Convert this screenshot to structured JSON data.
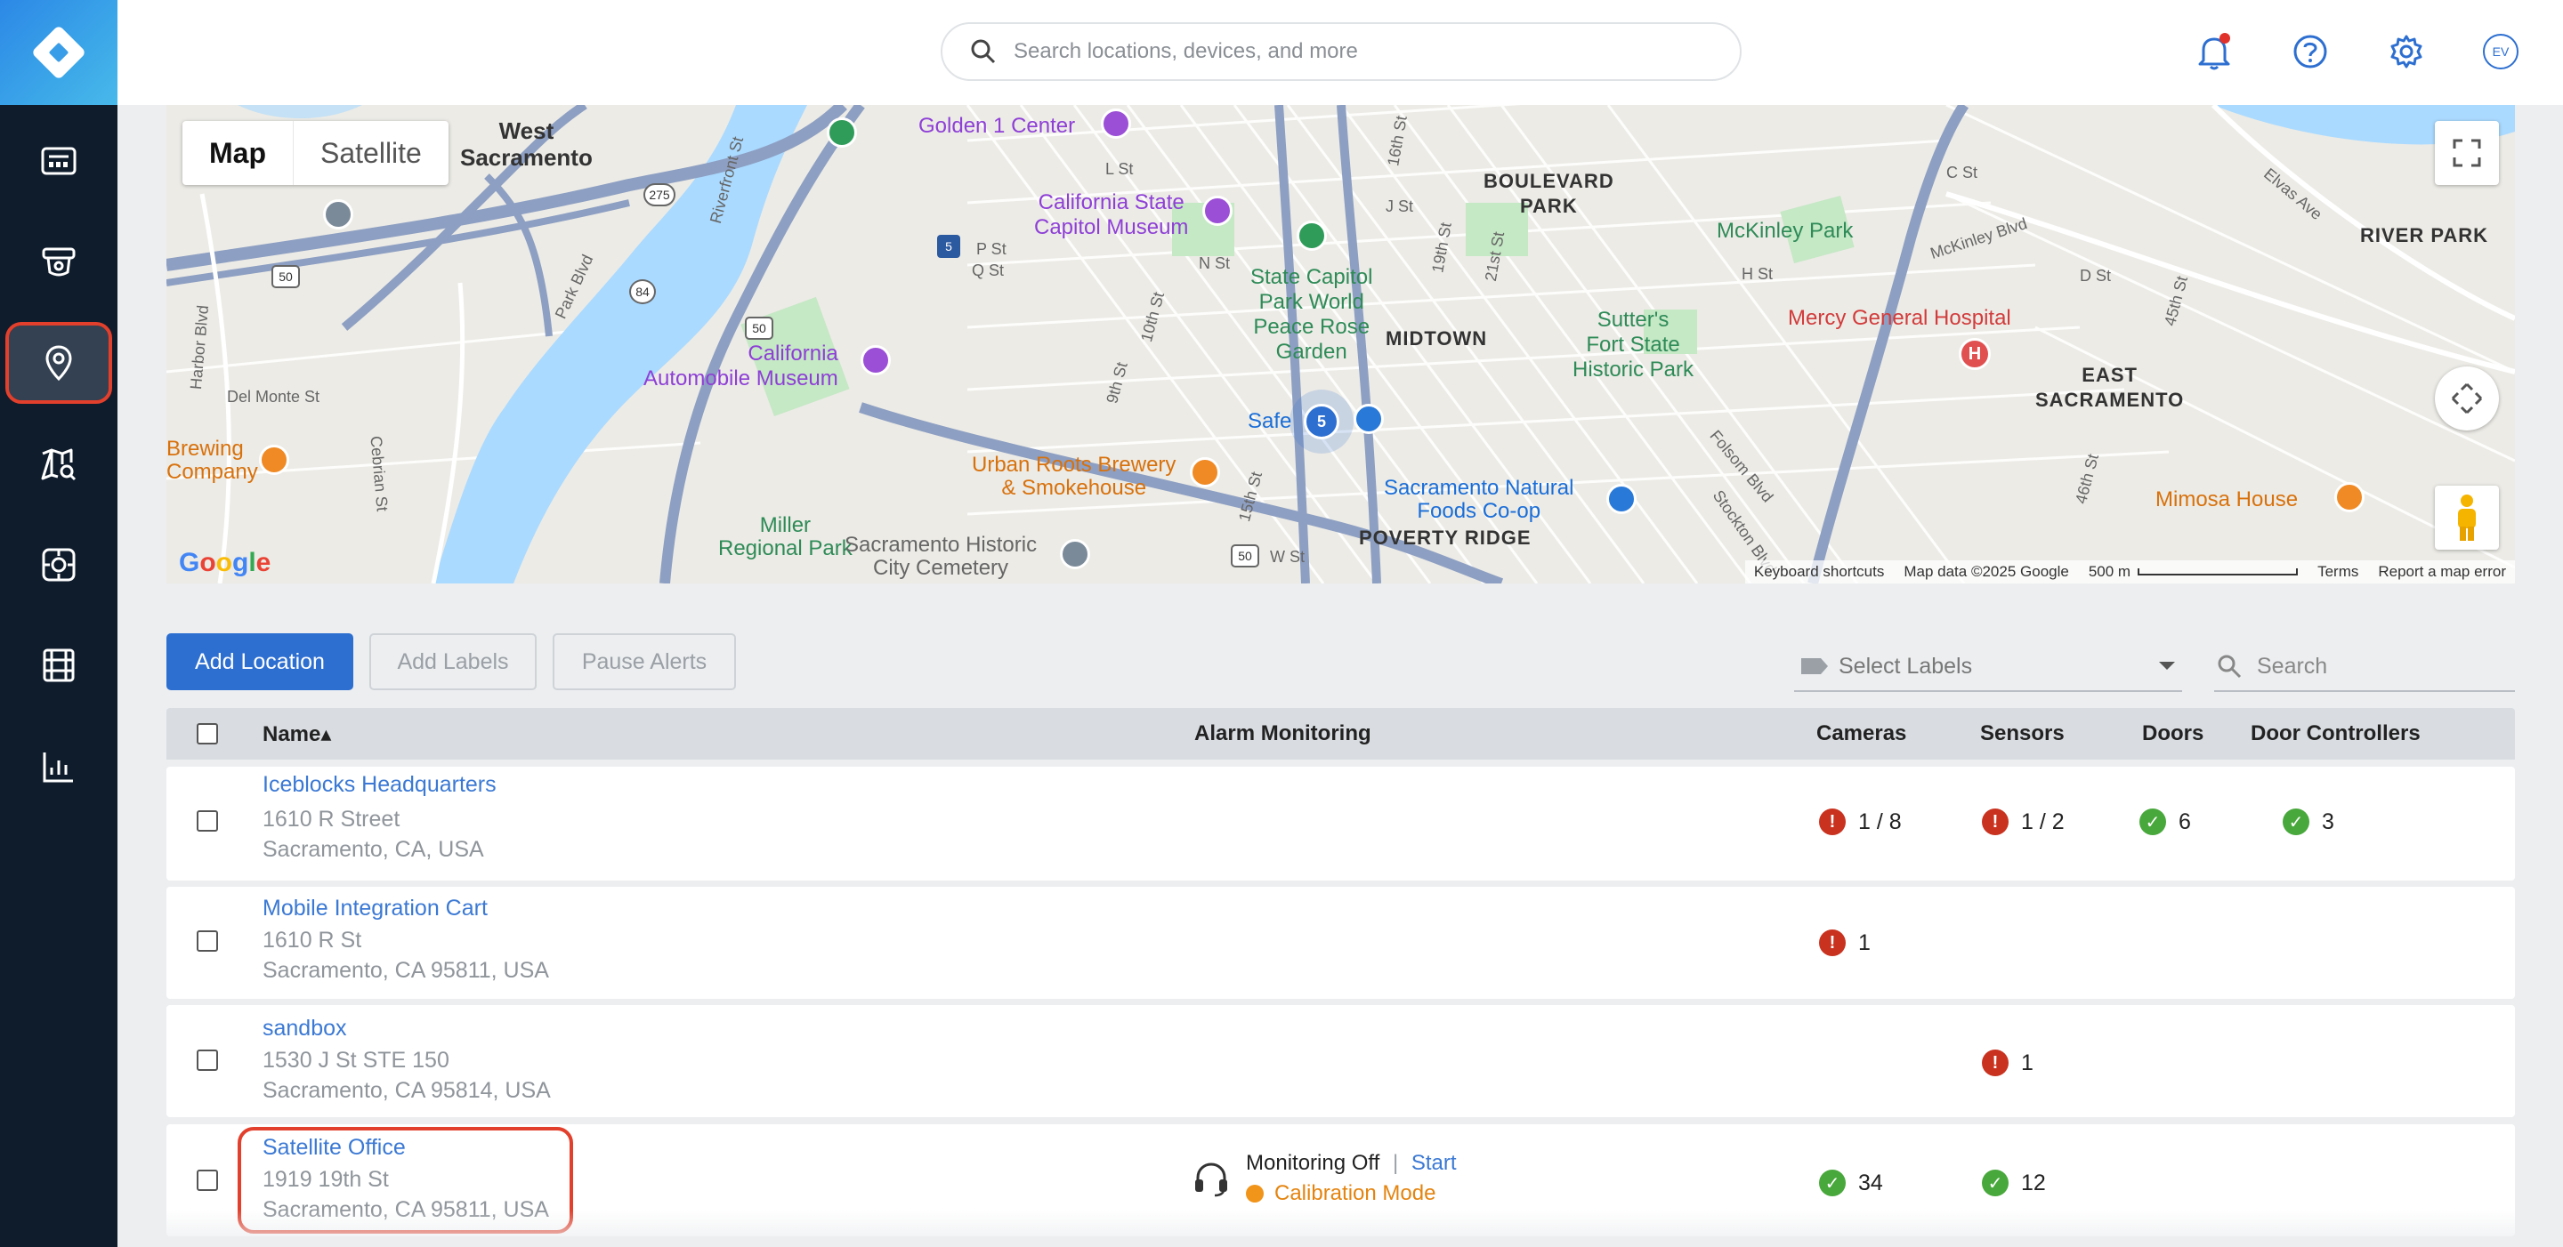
{
  "header": {
    "search_placeholder": "Search locations, devices, and more",
    "avatar_initials": "EV"
  },
  "map": {
    "type_map": "Map",
    "type_satellite": "Satellite",
    "cluster_count": "5",
    "labels": {
      "west_sacramento": "West\nSacramento",
      "boulevard_park": "BOULEVARD\nPARK",
      "midtown": "MIDTOWN",
      "east_sacramento": "EAST\nSACRAMENTO",
      "river_park": "RIVER PARK",
      "poverty_ridge": "POVERTY RIDGE",
      "golden1": "Golden 1 Center",
      "capitol_museum": "California State\nCapitol Museum",
      "capitol_park": "State Capitol\nPark World\nPeace Rose\nGarden",
      "mckinley": "McKinley Park",
      "mercy": "Mercy General Hospital",
      "sutters_fort": "Sutter's\nFort State\nHistoric Park",
      "auto_museum": "California\nAutomobile Museum",
      "urban_roots": "Urban Roots Brewery\n& Smokehouse",
      "natural_foods": "Sacramento Natural\nFoods Co-op",
      "mimosa": "Mimosa House",
      "miller": "Miller\nRegional Park",
      "cemetery": "Sacramento Historic\nCity Cemetery",
      "brewing": "Brewing\nCompany",
      "safe": "Safe",
      "del_monte": "Del Monte St"
    },
    "streets": [
      "L St",
      "N St",
      "P St",
      "Q St",
      "J St",
      "H St",
      "C St",
      "D St",
      "9th St",
      "10th St",
      "15th St",
      "16th St",
      "19th St",
      "21st St",
      "45th St",
      "46th St",
      "Park Blvd",
      "Harbor Blvd",
      "Riverfront St",
      "Cebrian St",
      "McKinley Blvd",
      "Folsom Blvd",
      "Stockton Blvd",
      "Elvas Ave",
      "W St"
    ],
    "highway_shields": [
      "50",
      "84",
      "275",
      "5",
      "50",
      "50"
    ],
    "attribution": {
      "shortcuts": "Keyboard shortcuts",
      "data": "Map data ©2025 Google",
      "scale": "500 m",
      "terms": "Terms",
      "report": "Report a map error"
    },
    "google": "Google"
  },
  "toolbar": {
    "add_location": "Add Location",
    "add_labels": "Add Labels",
    "pause_alerts": "Pause Alerts",
    "select_labels": "Select Labels",
    "search_placeholder": "Search"
  },
  "table": {
    "headers": {
      "name": "Name▴",
      "alarm": "Alarm Monitoring",
      "cameras": "Cameras",
      "sensors": "Sensors",
      "doors": "Doors",
      "controllers": "Door Controllers"
    },
    "rows": [
      {
        "name": "Iceblocks Headquarters",
        "address1": "1610 R Street",
        "address2": "Sacramento, CA, USA",
        "cameras": "1 / 8",
        "sensors": "1 / 2",
        "doors": "6",
        "controllers": "3"
      },
      {
        "name": "Mobile Integration Cart",
        "address1": "1610 R St",
        "address2": "Sacramento, CA 95811, USA",
        "cameras": "1"
      },
      {
        "name": "sandbox",
        "address1": "1530 J St STE 150",
        "address2": "Sacramento, CA 95814, USA",
        "sensors": "1"
      },
      {
        "name": "Satellite Office",
        "address1": "1919 19th St",
        "address2": "Sacramento, CA 95811, USA",
        "monitoring": "Monitoring Off",
        "separator": "|",
        "start": "Start",
        "mode": "Calibration Mode",
        "cameras": "34",
        "sensors": "12"
      }
    ]
  },
  "colors": {
    "sidebar": "#0f1c2c",
    "accent": "#2d6fd1",
    "error": "#c8321f",
    "ok": "#48a83c",
    "warning": "#f0941a",
    "highlight": "#e2402c"
  }
}
